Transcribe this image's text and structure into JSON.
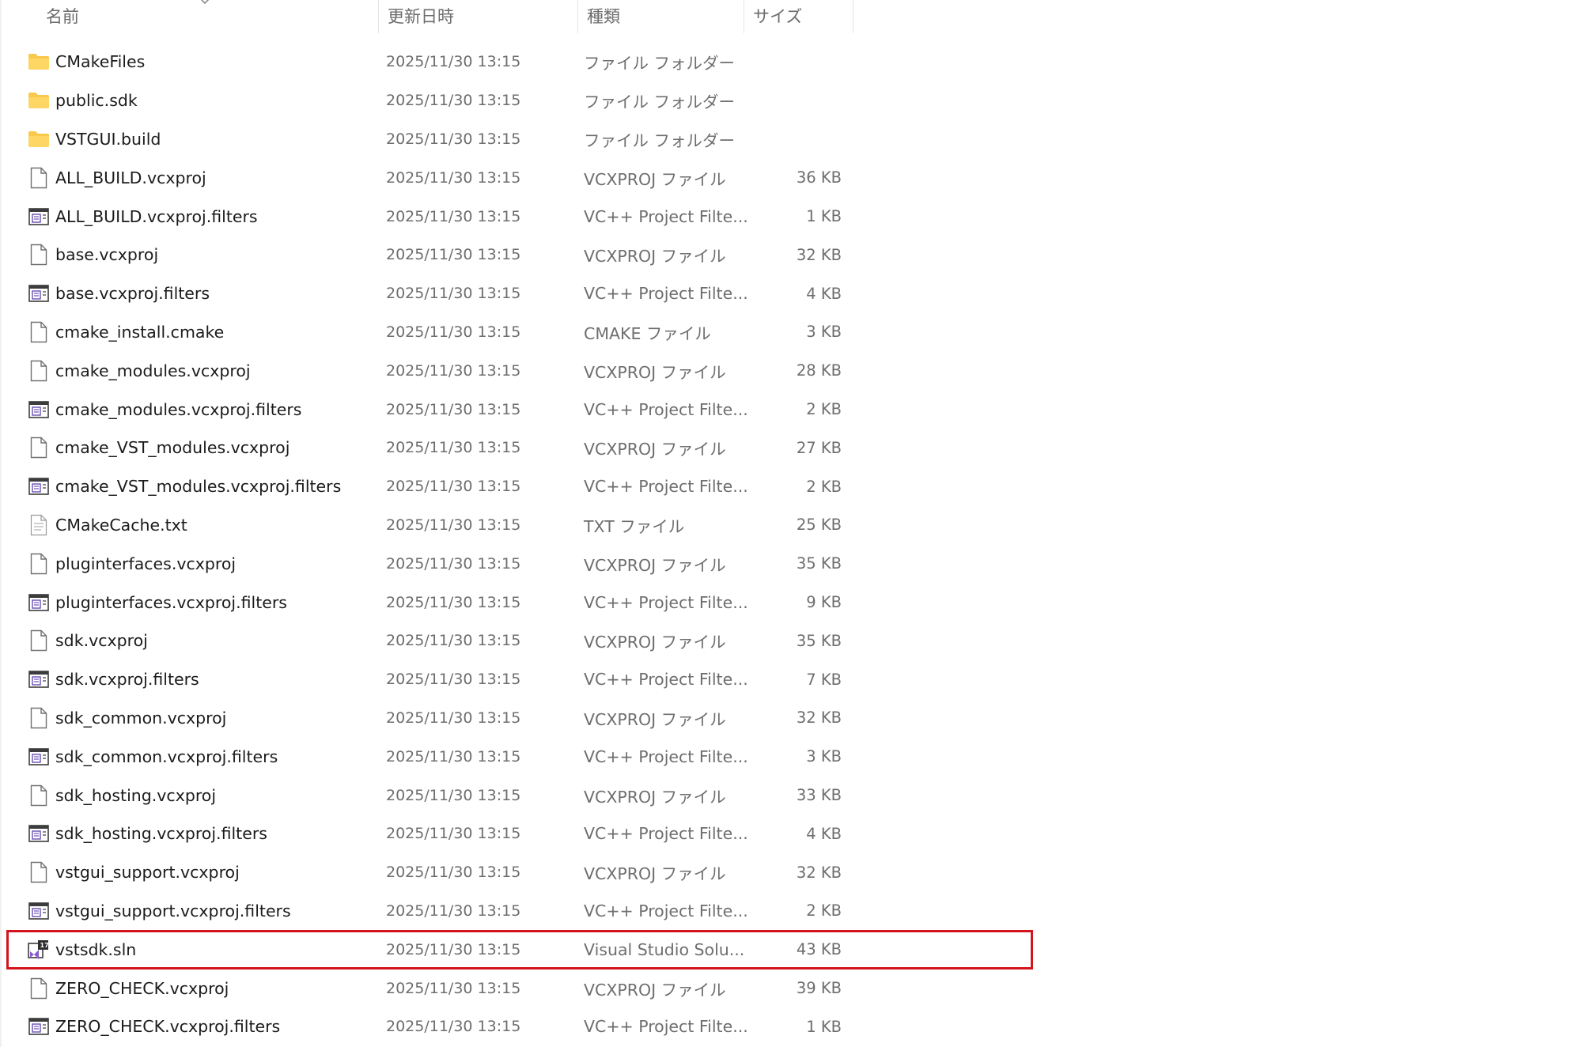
{
  "columns": {
    "name": "名前",
    "modified": "更新日時",
    "type": "種類",
    "size": "サイズ"
  },
  "files": [
    {
      "name": "CMakeFiles",
      "modified": "2025/11/30 13:15",
      "type": "ファイル フォルダー",
      "size": "",
      "icon": "folder-icon"
    },
    {
      "name": "public.sdk",
      "modified": "2025/11/30 13:15",
      "type": "ファイル フォルダー",
      "size": "",
      "icon": "folder-icon"
    },
    {
      "name": "VSTGUI.build",
      "modified": "2025/11/30 13:15",
      "type": "ファイル フォルダー",
      "size": "",
      "icon": "folder-icon"
    },
    {
      "name": "ALL_BUILD.vcxproj",
      "modified": "2025/11/30 13:15",
      "type": "VCXPROJ ファイル",
      "size": "36 KB",
      "icon": "blank-file-icon"
    },
    {
      "name": "ALL_BUILD.vcxproj.filters",
      "modified": "2025/11/30 13:15",
      "type": "VC++ Project Filte...",
      "size": "1 KB",
      "icon": "filters-file-icon"
    },
    {
      "name": "base.vcxproj",
      "modified": "2025/11/30 13:15",
      "type": "VCXPROJ ファイル",
      "size": "32 KB",
      "icon": "blank-file-icon"
    },
    {
      "name": "base.vcxproj.filters",
      "modified": "2025/11/30 13:15",
      "type": "VC++ Project Filte...",
      "size": "4 KB",
      "icon": "filters-file-icon"
    },
    {
      "name": "cmake_install.cmake",
      "modified": "2025/11/30 13:15",
      "type": "CMAKE ファイル",
      "size": "3 KB",
      "icon": "blank-file-icon"
    },
    {
      "name": "cmake_modules.vcxproj",
      "modified": "2025/11/30 13:15",
      "type": "VCXPROJ ファイル",
      "size": "28 KB",
      "icon": "blank-file-icon"
    },
    {
      "name": "cmake_modules.vcxproj.filters",
      "modified": "2025/11/30 13:15",
      "type": "VC++ Project Filte...",
      "size": "2 KB",
      "icon": "filters-file-icon"
    },
    {
      "name": "cmake_VST_modules.vcxproj",
      "modified": "2025/11/30 13:15",
      "type": "VCXPROJ ファイル",
      "size": "27 KB",
      "icon": "blank-file-icon"
    },
    {
      "name": "cmake_VST_modules.vcxproj.filters",
      "modified": "2025/11/30 13:15",
      "type": "VC++ Project Filte...",
      "size": "2 KB",
      "icon": "filters-file-icon"
    },
    {
      "name": "CMakeCache.txt",
      "modified": "2025/11/30 13:15",
      "type": "TXT ファイル",
      "size": "25 KB",
      "icon": "text-file-icon"
    },
    {
      "name": "pluginterfaces.vcxproj",
      "modified": "2025/11/30 13:15",
      "type": "VCXPROJ ファイル",
      "size": "35 KB",
      "icon": "blank-file-icon"
    },
    {
      "name": "pluginterfaces.vcxproj.filters",
      "modified": "2025/11/30 13:15",
      "type": "VC++ Project Filte...",
      "size": "9 KB",
      "icon": "filters-file-icon"
    },
    {
      "name": "sdk.vcxproj",
      "modified": "2025/11/30 13:15",
      "type": "VCXPROJ ファイル",
      "size": "35 KB",
      "icon": "blank-file-icon"
    },
    {
      "name": "sdk.vcxproj.filters",
      "modified": "2025/11/30 13:15",
      "type": "VC++ Project Filte...",
      "size": "7 KB",
      "icon": "filters-file-icon"
    },
    {
      "name": "sdk_common.vcxproj",
      "modified": "2025/11/30 13:15",
      "type": "VCXPROJ ファイル",
      "size": "32 KB",
      "icon": "blank-file-icon"
    },
    {
      "name": "sdk_common.vcxproj.filters",
      "modified": "2025/11/30 13:15",
      "type": "VC++ Project Filte...",
      "size": "3 KB",
      "icon": "filters-file-icon"
    },
    {
      "name": "sdk_hosting.vcxproj",
      "modified": "2025/11/30 13:15",
      "type": "VCXPROJ ファイル",
      "size": "33 KB",
      "icon": "blank-file-icon"
    },
    {
      "name": "sdk_hosting.vcxproj.filters",
      "modified": "2025/11/30 13:15",
      "type": "VC++ Project Filte...",
      "size": "4 KB",
      "icon": "filters-file-icon"
    },
    {
      "name": "vstgui_support.vcxproj",
      "modified": "2025/11/30 13:15",
      "type": "VCXPROJ ファイル",
      "size": "32 KB",
      "icon": "blank-file-icon"
    },
    {
      "name": "vstgui_support.vcxproj.filters",
      "modified": "2025/11/30 13:15",
      "type": "VC++ Project Filte...",
      "size": "2 KB",
      "icon": "filters-file-icon"
    },
    {
      "name": "vstsdk.sln",
      "modified": "2025/11/30 13:15",
      "type": "Visual Studio Solu...",
      "size": "43 KB",
      "icon": "visual-studio-solution-icon",
      "highlighted": true
    },
    {
      "name": "ZERO_CHECK.vcxproj",
      "modified": "2025/11/30 13:15",
      "type": "VCXPROJ ファイル",
      "size": "39 KB",
      "icon": "blank-file-icon"
    },
    {
      "name": "ZERO_CHECK.vcxproj.filters",
      "modified": "2025/11/30 13:15",
      "type": "VC++ Project Filte...",
      "size": "1 KB",
      "icon": "filters-file-icon"
    }
  ],
  "colors": {
    "highlight_border": "#d4141c",
    "folder": "#f8c94a",
    "secondary_text": "#6e6e6e"
  }
}
